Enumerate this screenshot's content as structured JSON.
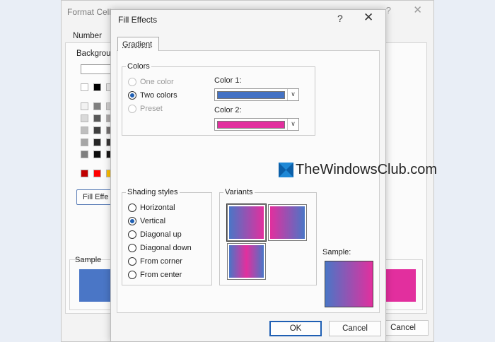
{
  "background_dialog": {
    "title": "Format Cells",
    "help": "?",
    "close": "✕",
    "tab_number": "Number",
    "background_label": "Backgrou",
    "fill_effects_btn": "Fill Effe",
    "sample_label": "Sample",
    "cancel": "Cancel"
  },
  "dialog": {
    "title": "Fill Effects",
    "help": "?",
    "close": "✕",
    "tab": "Gradient",
    "colors": {
      "label": "Colors",
      "one_color": "One color",
      "two_colors": "Two colors",
      "preset": "Preset",
      "selected": "two_colors",
      "color1_label": "Color 1:",
      "color2_label": "Color 2:",
      "color1": "#4472c4",
      "color2": "#e22f9e"
    },
    "shading": {
      "label": "Shading styles",
      "options": [
        "Horizontal",
        "Vertical",
        "Diagonal up",
        "Diagonal down",
        "From corner",
        "From center"
      ],
      "selected": "Vertical"
    },
    "variants_label": "Variants",
    "sample_label": "Sample:",
    "ok": "OK",
    "cancel": "Cancel"
  },
  "watermark": "TheWindowsClub.com",
  "icons": [
    "close-icon",
    "help-icon",
    "chevron-down-icon",
    "windows-logo-icon"
  ]
}
